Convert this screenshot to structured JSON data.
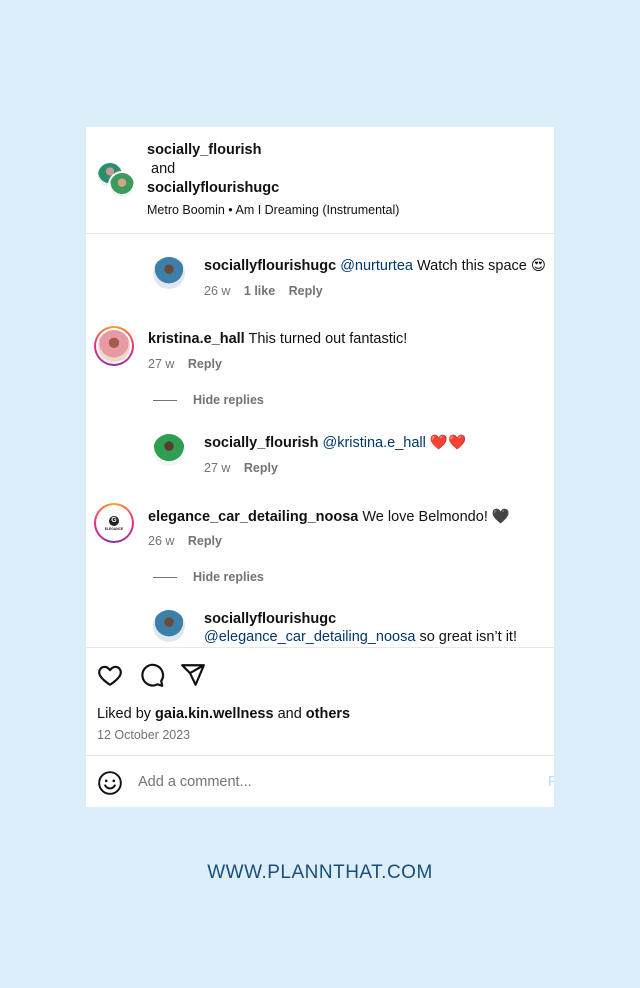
{
  "header": {
    "user1": "socially_flourish",
    "joiner": "and",
    "user2": "sociallyflourishugc",
    "song": {
      "artist": "Metro Boomin",
      "separator": "•",
      "title": "Am I Dreaming (Instrumental)"
    }
  },
  "comments": [
    {
      "username": "sociallyflourishugc",
      "mention": "@nurturtea",
      "text": "Watch this space 😍",
      "time": "26 w",
      "likes": "1 like",
      "reply": "Reply"
    },
    {
      "username": "kristina.e_hall",
      "mention": "",
      "text": "This turned out fantastic!",
      "time": "27 w",
      "reply": "Reply",
      "hide_replies": "Hide replies"
    },
    {
      "username": "socially_flourish",
      "mention": "@kristina.e_hall",
      "text": "❤️❤️",
      "time": "27 w",
      "reply": "Reply"
    },
    {
      "username": "elegance_car_detailing_noosa",
      "mention": "",
      "text": "We love Belmondo! 🖤",
      "time": "26 w",
      "reply": "Reply",
      "hide_replies": "Hide replies",
      "logo_text": "ELEGANCE"
    },
    {
      "username": "sociallyflourishugc",
      "mention": "@elegance_car_detailing_noosa",
      "text": "so great isn’t it!"
    }
  ],
  "actions": {
    "like_icon": "heart-icon",
    "comment_icon": "comment-bubble-icon",
    "share_icon": "paper-plane-icon"
  },
  "likes": {
    "prefix": "Liked by",
    "user": "gaia.kin.wellness",
    "middle": "and",
    "others": "others"
  },
  "date": "12 October 2023",
  "add_comment": {
    "placeholder": "Add a comment...",
    "post_label": "P",
    "emoji_icon": "smiley-icon"
  },
  "footer": {
    "url": "WWW.PLANNTHAT.COM"
  }
}
